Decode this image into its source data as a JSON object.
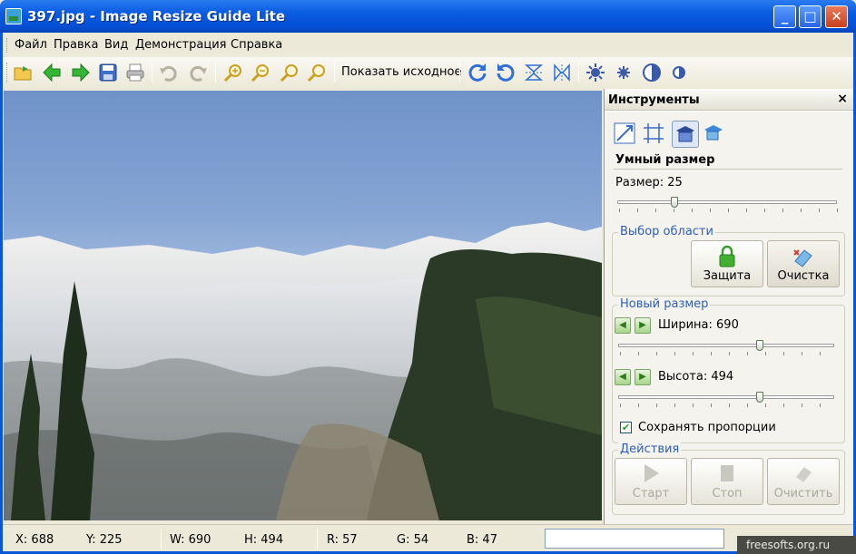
{
  "window": {
    "title": "397.jpg - Image Resize Guide Lite"
  },
  "menu": [
    "Файл",
    "Правка",
    "Вид",
    "Демонстрация",
    "Справка"
  ],
  "toolbar": {
    "show_original": "Показать исходное"
  },
  "tools_panel": {
    "title": "Инструменты",
    "close": "×",
    "smart_size": {
      "heading": "Умный размер",
      "size_label": "Размер: 25",
      "size_value": 25
    },
    "area_select": {
      "title": "Выбор области",
      "protect": "Защита",
      "clear": "Очистка"
    },
    "new_size": {
      "title": "Новый размер",
      "width_label": "Ширина: 690",
      "height_label": "Высота: 494",
      "width_value": 690,
      "height_value": 494,
      "keep_proportions": "Сохранять пропорции",
      "keep_checked": true
    },
    "actions": {
      "title": "Действия",
      "start": "Старт",
      "stop": "Стоп",
      "clear": "Очистить"
    }
  },
  "status": {
    "x": "X: 688",
    "y": "Y: 225",
    "w": "W: 690",
    "h": "H: 494",
    "r": "R: 57",
    "g": "G: 54",
    "b": "B: 47"
  },
  "watermark": "freesofts.org.ru",
  "colors": {
    "title_bar": "#0a5ce0",
    "accent_text": "#2f5fb8",
    "window_bg": "#ece9d8"
  }
}
